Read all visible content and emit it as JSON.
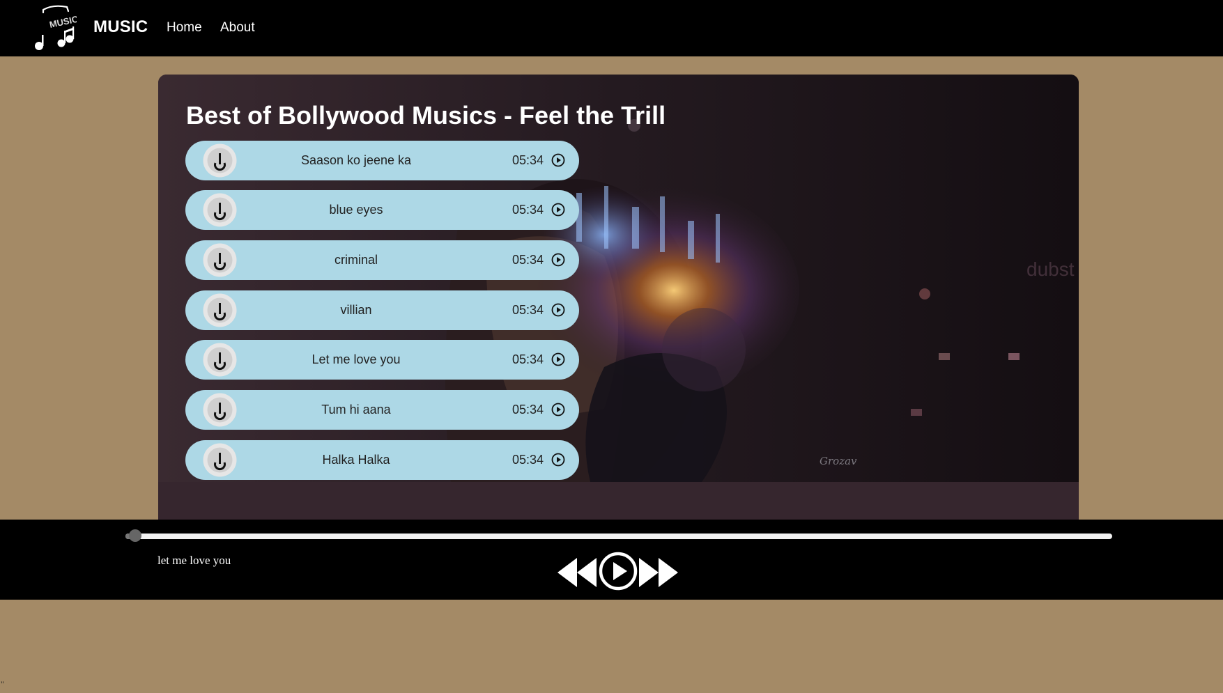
{
  "navbar": {
    "logo_text": "MUSIC",
    "brand": "MUSIC",
    "links": [
      "Home",
      "About"
    ]
  },
  "playlist": {
    "title": "Best of Bollywood Musics - Feel the Trill",
    "songs": [
      {
        "name": "Saason ko jeene ka",
        "duration": "05:34"
      },
      {
        "name": "blue eyes",
        "duration": "05:34"
      },
      {
        "name": "criminal",
        "duration": "05:34"
      },
      {
        "name": "villian",
        "duration": "05:34"
      },
      {
        "name": "Let me love you",
        "duration": "05:34"
      },
      {
        "name": "Tum hi aana",
        "duration": "05:34"
      },
      {
        "name": "Halka Halka",
        "duration": "05:34"
      }
    ],
    "watermark": "dubst",
    "artist_signature": "Grozav"
  },
  "player": {
    "now_playing": "let me love you",
    "progress_fraction": 0.01,
    "icons": [
      "previous-icon",
      "play-icon",
      "next-icon"
    ]
  },
  "page_footer": "\"",
  "colors": {
    "page_bg": "#a48a66",
    "nav_bg": "#000000",
    "song_item_bg": "#add8e6",
    "panel_bg": "#2f2228"
  }
}
